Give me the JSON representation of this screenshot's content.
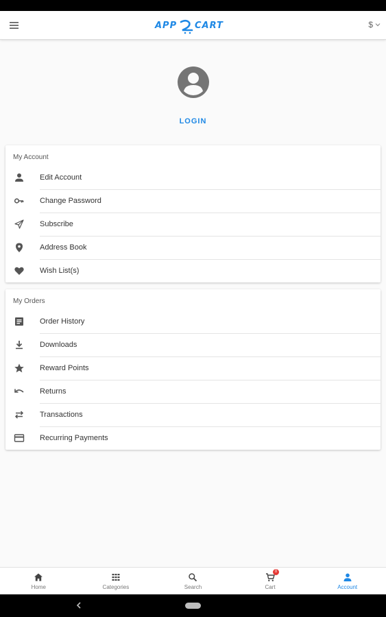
{
  "header": {
    "logo_text": "APP CART",
    "currency": "$"
  },
  "profile": {
    "login_label": "LOGIN"
  },
  "my_account": {
    "title": "My Account",
    "items": [
      {
        "label": "Edit Account",
        "icon": "person-icon"
      },
      {
        "label": "Change Password",
        "icon": "key-icon"
      },
      {
        "label": "Subscribe",
        "icon": "send-icon"
      },
      {
        "label": "Address Book",
        "icon": "location-pin-icon"
      },
      {
        "label": "Wish List(s)",
        "icon": "heart-icon"
      }
    ]
  },
  "my_orders": {
    "title": "My Orders",
    "items": [
      {
        "label": "Order History",
        "icon": "history-icon"
      },
      {
        "label": "Downloads",
        "icon": "download-icon"
      },
      {
        "label": "Reward Points",
        "icon": "star-icon"
      },
      {
        "label": "Returns",
        "icon": "undo-icon"
      },
      {
        "label": "Transactions",
        "icon": "swap-icon"
      },
      {
        "label": "Recurring Payments",
        "icon": "card-icon"
      }
    ]
  },
  "bottom_nav": {
    "items": [
      {
        "label": "Home",
        "icon": "home-icon"
      },
      {
        "label": "Categories",
        "icon": "grid-icon"
      },
      {
        "label": "Search",
        "icon": "search-icon"
      },
      {
        "label": "Cart",
        "icon": "cart-icon",
        "badge": "0"
      },
      {
        "label": "Account",
        "icon": "account-icon",
        "active": true
      }
    ]
  },
  "colors": {
    "accent": "#1e88e5",
    "icon": "#555555",
    "badge": "#e53935"
  }
}
